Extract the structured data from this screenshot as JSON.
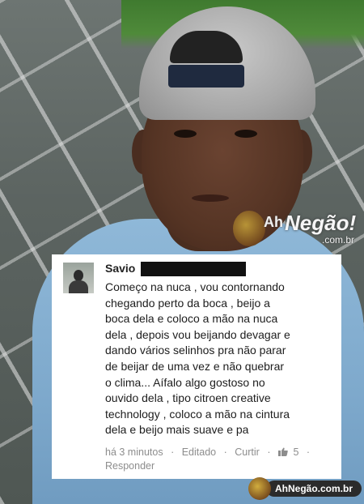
{
  "comment": {
    "author": "Savio",
    "lines": [
      "Começo na nuca , vou contornando",
      "chegando perto da boca , beijo a",
      "boca dela e coloco a mão na nuca",
      "dela , depois vou beijando devagar e",
      "dando vários selinhos pra não parar",
      "de beijar de uma vez e não quebrar",
      "o clima... Aífalo algo gostoso no",
      "ouvido dela , tipo citroen creative",
      "technology , coloco a mão na cintura",
      "dela e beijo mais suave e pa"
    ],
    "time": "há 3 minutos",
    "edited": "Editado",
    "like": "Curtir",
    "like_count": "5",
    "reply": "Responder",
    "separator": "·"
  },
  "watermark_top": {
    "prefix": "Ah",
    "brand": "Negão!",
    "domain": ".com.br"
  },
  "watermark_bottom": {
    "text": "AhNegão.com.br"
  },
  "colors": {
    "card_bg": "#ffffff",
    "meta_text": "#8d8d8d",
    "redaction": "#111111",
    "shirt": "#8fb8d8"
  },
  "icons": {
    "like": "thumbs-up-icon",
    "mascot": "mascot-logo-icon"
  }
}
